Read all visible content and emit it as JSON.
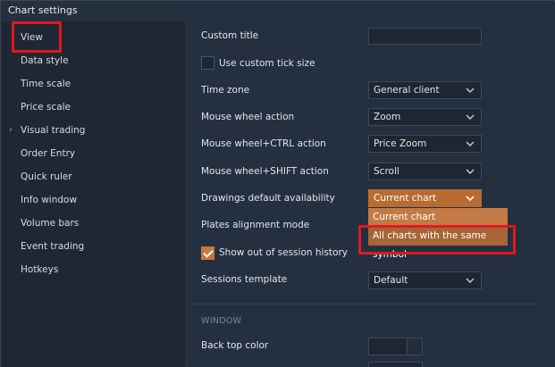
{
  "dialog": {
    "title": "Chart settings",
    "close_icon": "close-icon"
  },
  "sidebar": {
    "items": [
      {
        "label": "View",
        "selected": true,
        "expandable": false
      },
      {
        "label": "Data style",
        "expandable": false
      },
      {
        "label": "Time scale",
        "expandable": false
      },
      {
        "label": "Price scale",
        "expandable": false
      },
      {
        "label": "Visual trading",
        "expandable": true
      },
      {
        "label": "Order Entry",
        "expandable": false
      },
      {
        "label": "Quick ruler",
        "expandable": false
      },
      {
        "label": "Info window",
        "expandable": false
      },
      {
        "label": "Volume bars",
        "expandable": false
      },
      {
        "label": "Event trading",
        "expandable": false
      },
      {
        "label": "Hotkeys",
        "expandable": false
      }
    ]
  },
  "view": {
    "custom_title": {
      "label": "Custom title",
      "value": ""
    },
    "custom_tick_size": {
      "label": "Use custom tick size",
      "checked": false
    },
    "time_zone": {
      "label": "Time zone",
      "value": "General client"
    },
    "mouse_wheel": {
      "label": "Mouse wheel action",
      "value": "Zoom"
    },
    "mouse_wheel_ctrl": {
      "label": "Mouse wheel+CTRL action",
      "value": "Price Zoom"
    },
    "mouse_wheel_shift": {
      "label": "Mouse wheel+SHIFT action",
      "value": "Scroll"
    },
    "drawings_availability": {
      "label": "Drawings default availability",
      "value": "Current chart",
      "open": true,
      "options": [
        "Current chart",
        "All charts with the same symbol"
      ],
      "hovered_option": "All charts with the same symbol"
    },
    "plates_alignment": {
      "label": "Plates alignment mode"
    },
    "out_of_session": {
      "label": "Show out of session history",
      "checked": true
    },
    "sessions_template": {
      "label": "Sessions template",
      "value": "Default"
    }
  },
  "window_section": {
    "title": "WINDOW",
    "back_top_color": {
      "label": "Back top color"
    }
  },
  "colors": {
    "accent": "#c8763e",
    "dropdown_bg": "#c47a45",
    "annotation_red": "#e0191e"
  }
}
